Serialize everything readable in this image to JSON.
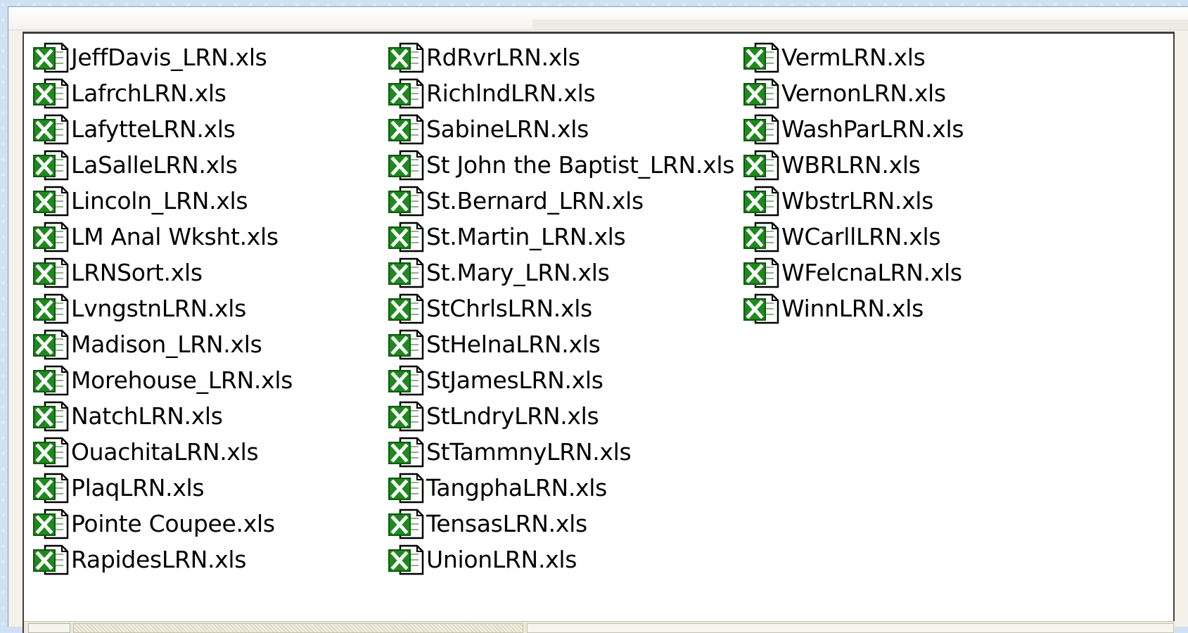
{
  "colors": {
    "excel_green": "#1e8a1e",
    "excel_dark": "#0c5a0c",
    "page_bg": "#ffffff"
  },
  "icon": "excel-spreadsheet-icon",
  "files": [
    [
      "JeffDavis_LRN.xls",
      "LafrchLRN.xls",
      "LafytteLRN.xls",
      "LaSalleLRN.xls",
      "Lincoln_LRN.xls",
      "LM Anal Wksht.xls",
      "LRNSort.xls",
      "LvngstnLRN.xls",
      "Madison_LRN.xls",
      "Morehouse_LRN.xls",
      "NatchLRN.xls",
      "OuachitaLRN.xls",
      "PlaqLRN.xls",
      "Pointe Coupee.xls",
      "RapidesLRN.xls"
    ],
    [
      "RdRvrLRN.xls",
      "RichlndLRN.xls",
      "SabineLRN.xls",
      "St John the Baptist_LRN.xls",
      "St.Bernard_LRN.xls",
      "St.Martin_LRN.xls",
      "St.Mary_LRN.xls",
      "StChrlsLRN.xls",
      "StHelnaLRN.xls",
      "StJamesLRN.xls",
      "StLndryLRN.xls",
      "StTammnyLRN.xls",
      "TangphaLRN.xls",
      "TensasLRN.xls",
      "UnionLRN.xls"
    ],
    [
      "VermLRN.xls",
      "VernonLRN.xls",
      "WashParLRN.xls",
      "WBRLRN.xls",
      "WbstrLRN.xls",
      "WCarllLRN.xls",
      "WFelcnaLRN.xls",
      "WinnLRN.xls"
    ]
  ]
}
